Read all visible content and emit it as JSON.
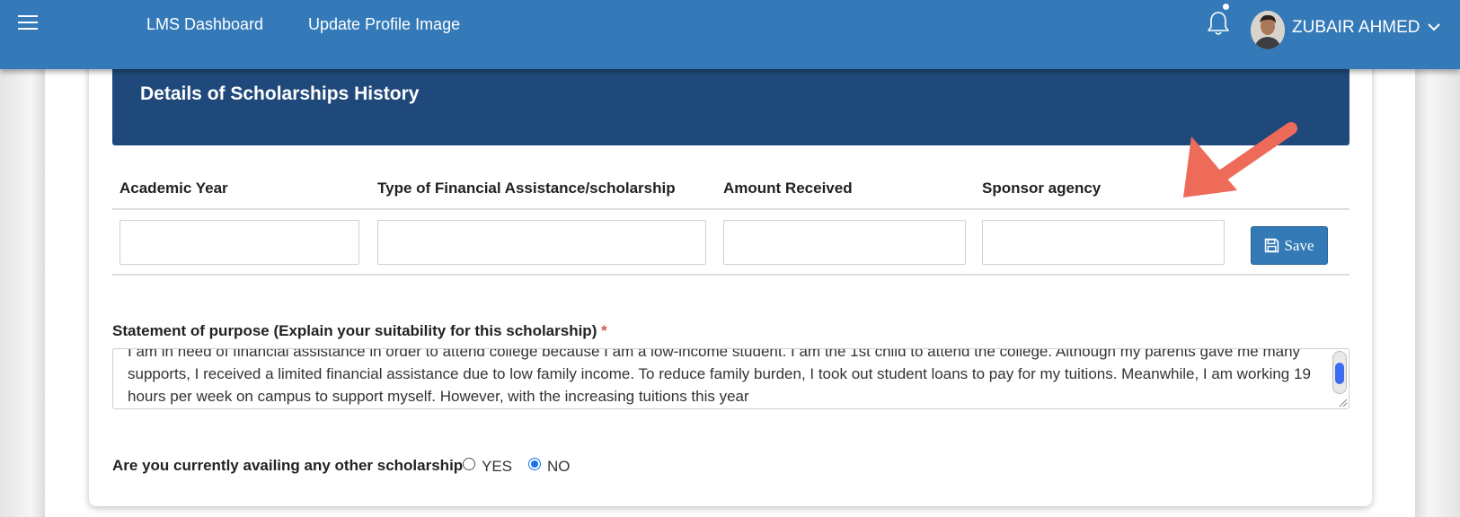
{
  "header": {
    "nav_links": [
      "LMS Dashboard",
      "Update Profile Image"
    ],
    "user_name": "ZUBAIR AHMED"
  },
  "section": {
    "title": "Details of Scholarships History"
  },
  "table": {
    "columns": [
      "Academic Year",
      "Type of Financial Assistance/scholarship",
      "Amount Received",
      "Sponsor agency"
    ],
    "inputs": {
      "academic_year": "",
      "financial_assistance_type": "",
      "amount_received": "",
      "sponsor_agency": ""
    },
    "save_label": "Save"
  },
  "statement": {
    "label": "Statement of purpose (Explain your suitability for this scholarship)",
    "required_mark": "*",
    "value": "I am in need of financial assistance in order to attend college because I am a low-income student. I am the 1st child to attend the college. Although my parents gave me many supports, I received a limited financial assistance due to low family income. To reduce family burden, I took out student loans to pay for my tuitions. Meanwhile, I am working 19 hours per week on campus to support myself. However, with the increasing tuitions this year"
  },
  "other_scholarship": {
    "question": "Are you currently availing any other scholarship",
    "required_mark": "*",
    "options": [
      "YES",
      "NO"
    ],
    "selected": "NO"
  },
  "colors": {
    "topbar": "#3479b8",
    "section_header": "#20497b",
    "save_button": "#337ab7",
    "annotation_arrow": "#ee6b5a",
    "required": "#d9534f"
  },
  "icons": {
    "menu": "hamburger-icon",
    "notifications": "bell-icon",
    "user_menu": "chevron-down-icon",
    "save": "floppy-disk-icon"
  }
}
